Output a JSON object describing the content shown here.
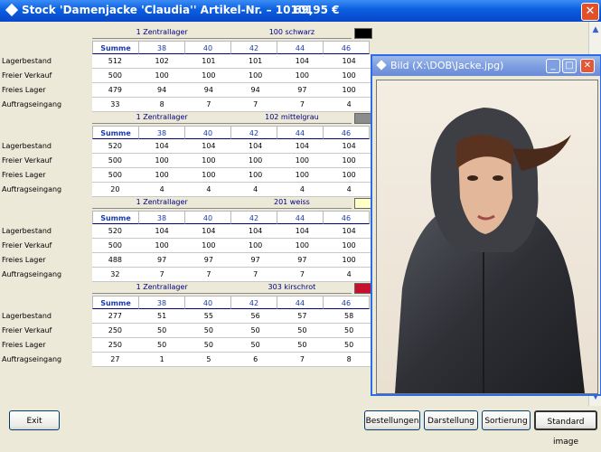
{
  "window": {
    "title": "Stock 'Damenjacke 'Claudia'' Artikel-Nr. – 10101",
    "price": "69,95 €",
    "close": "✕"
  },
  "columns": [
    "Summe",
    "38",
    "40",
    "42",
    "44",
    "46"
  ],
  "row_labels": [
    "Lagerbestand",
    "Freier Verkauf",
    "Freies Lager",
    "Auftragseingang"
  ],
  "lager": "1 Zentrallager",
  "blocks": [
    {
      "color_label": "100 schwarz",
      "swatch": "#000000",
      "rows": [
        [
          "512",
          "102",
          "101",
          "101",
          "104",
          "104"
        ],
        [
          "500",
          "100",
          "100",
          "100",
          "100",
          "100"
        ],
        [
          "479",
          "94",
          "94",
          "94",
          "97",
          "100"
        ],
        [
          "33",
          "8",
          "7",
          "7",
          "7",
          "4"
        ]
      ]
    },
    {
      "color_label": "102 mittelgrau",
      "swatch": "#8c8c8c",
      "rows": [
        [
          "520",
          "104",
          "104",
          "104",
          "104",
          "104"
        ],
        [
          "500",
          "100",
          "100",
          "100",
          "100",
          "100"
        ],
        [
          "500",
          "100",
          "100",
          "100",
          "100",
          "100"
        ],
        [
          "20",
          "4",
          "4",
          "4",
          "4",
          "4"
        ]
      ]
    },
    {
      "color_label": "201 weiss",
      "swatch": "#ffffc8",
      "rows": [
        [
          "520",
          "104",
          "104",
          "104",
          "104",
          "104"
        ],
        [
          "500",
          "100",
          "100",
          "100",
          "100",
          "100"
        ],
        [
          "488",
          "97",
          "97",
          "97",
          "97",
          "100"
        ],
        [
          "32",
          "7",
          "7",
          "7",
          "7",
          "4"
        ]
      ]
    },
    {
      "color_label": "303 kirschrot",
      "swatch": "#c8102e",
      "rows": [
        [
          "277",
          "51",
          "55",
          "56",
          "57",
          "58"
        ],
        [
          "250",
          "50",
          "50",
          "50",
          "50",
          "50"
        ],
        [
          "250",
          "50",
          "50",
          "50",
          "50",
          "50"
        ],
        [
          "27",
          "1",
          "5",
          "6",
          "7",
          "8"
        ]
      ]
    }
  ],
  "image_window": {
    "title": "Bild (X:\\DOB\\Jacke.jpg)",
    "minimize": "_",
    "maximize": "□",
    "close": "✕"
  },
  "buttons": {
    "exit": "Exit",
    "bestellungen": "Bestellungen",
    "darstellung": "Darstellung",
    "sortierung": "Sortierung",
    "standard_image": "Standard image"
  },
  "icons": {
    "scroll_up": "▲",
    "scroll_down": "▼"
  }
}
